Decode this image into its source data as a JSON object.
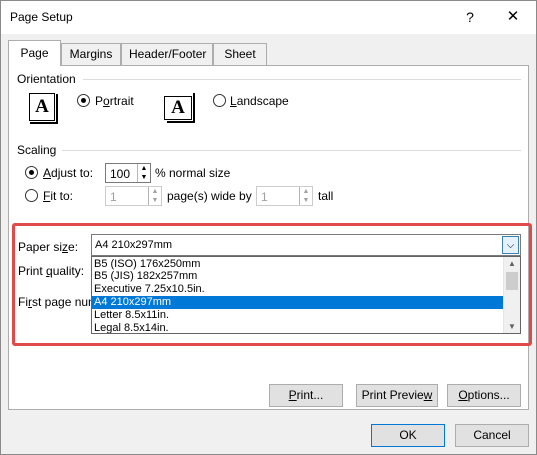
{
  "window": {
    "title": "Page Setup",
    "help_glyph": "?",
    "close_glyph": "✕"
  },
  "tabs": [
    {
      "label": "Page",
      "active": true
    },
    {
      "label": "Margins",
      "active": false
    },
    {
      "label": "Header/Footer",
      "active": false
    },
    {
      "label": "Sheet",
      "active": false
    }
  ],
  "orientation": {
    "label": "Orientation",
    "icon_letter": "A",
    "portrait": {
      "label_prefix": "P",
      "label_u": "o",
      "label_rest": "rtrait",
      "checked": true
    },
    "landscape": {
      "label_prefix": "",
      "label_u": "L",
      "label_rest": "andscape",
      "checked": false
    }
  },
  "scaling": {
    "label": "Scaling",
    "adjust": {
      "label_prefix": "",
      "label_u": "A",
      "label_rest": "djust to:",
      "value": "100",
      "suffix": "% normal size",
      "checked": true
    },
    "fit": {
      "label_prefix": "",
      "label_u": "F",
      "label_rest": "it to:",
      "wide_value": "1",
      "wide_label": "page(s) wide by",
      "tall_value": "1",
      "tall_label": "tall",
      "checked": false
    }
  },
  "paper": {
    "size_label_prefix": "Paper si",
    "size_label_u": "z",
    "size_label_rest": "e:",
    "selected": "A4 210x297mm",
    "options": [
      {
        "label": "B5 (ISO) 176x250mm",
        "selected": false
      },
      {
        "label": "B5 (JIS) 182x257mm",
        "selected": false
      },
      {
        "label": "Executive 7.25x10.5in.",
        "selected": false
      },
      {
        "label": "A4 210x297mm",
        "selected": true
      },
      {
        "label": "Letter 8.5x11in.",
        "selected": false
      },
      {
        "label": "Legal 8.5x14in.",
        "selected": false
      }
    ]
  },
  "print_quality": {
    "label_prefix": "Print ",
    "label_u": "q",
    "label_rest": "uality:"
  },
  "first_page": {
    "label_prefix": "Fi",
    "label_u": "r",
    "label_rest": "st page num"
  },
  "buttons": {
    "print": {
      "u": "P",
      "rest": "rint..."
    },
    "print_preview": {
      "prefix": "Print Previe",
      "u": "w",
      "rest": ""
    },
    "options": {
      "u": "O",
      "rest": "ptions..."
    },
    "ok": "OK",
    "cancel": "Cancel"
  },
  "colors": {
    "highlight_border": "#e04a4a",
    "selection": "#0078d7"
  }
}
